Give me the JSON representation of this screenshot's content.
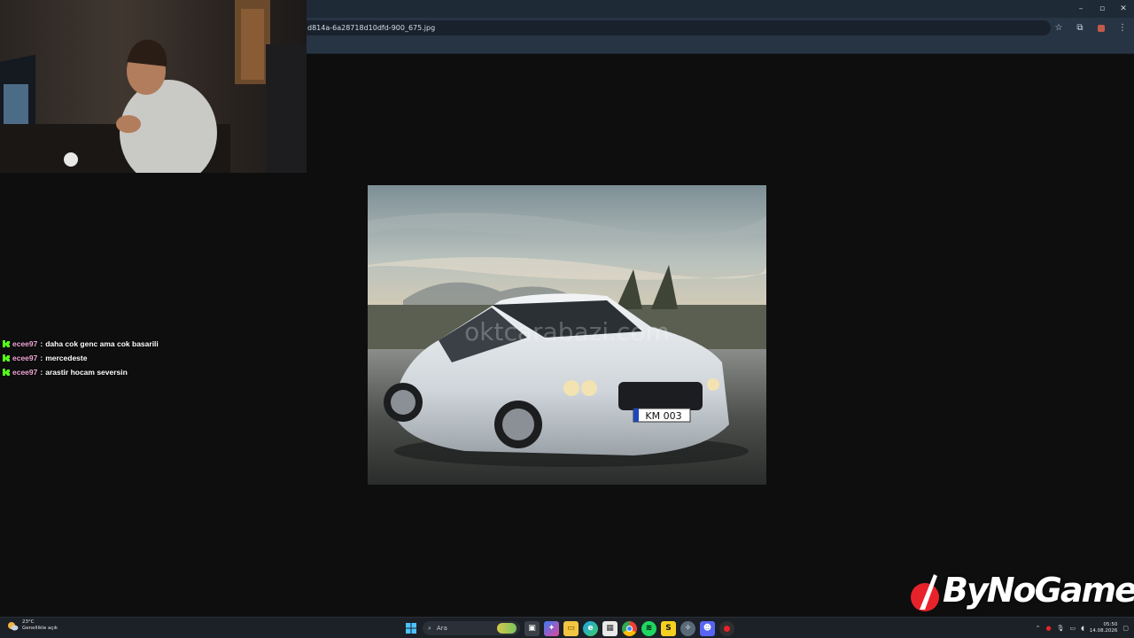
{
  "browser": {
    "url": "d814a-6a28718d10dfd-900_675.jpg",
    "window_controls": {
      "minimize": "–",
      "maximize": "▫",
      "close": "✕"
    },
    "toolbar_icons": [
      "star-icon",
      "extensions-icon",
      "profile-icon",
      "menu-icon"
    ]
  },
  "image": {
    "watermark": "oktcarabazi.com",
    "plate": "KM 003"
  },
  "chat": {
    "messages": [
      {
        "user": "ecee97",
        "separator": ":",
        "text": "daha cok genc ama cok basarili"
      },
      {
        "user": "ecee97",
        "separator": ":",
        "text": "mercedeste"
      },
      {
        "user": "ecee97",
        "separator": ":",
        "text": "arastir hocam seversin"
      }
    ],
    "badge_color": "#53fc18"
  },
  "logo": {
    "text": "ByNoGame",
    "accent": "#e8222a"
  },
  "taskbar": {
    "weather": {
      "temp": "23°C",
      "desc": "Genellikle açık"
    },
    "search_placeholder": "Ara",
    "apps": [
      "start-icon",
      "search-icon",
      "task-view-icon",
      "copilot-icon",
      "file-explorer-icon",
      "edge-icon",
      "store-icon",
      "chrome-icon",
      "spotify-icon",
      "s-app-icon",
      "network-app-icon",
      "discord-icon",
      "recording-icon"
    ],
    "clock_time": "05:50",
    "clock_date": "14.08.2026"
  }
}
